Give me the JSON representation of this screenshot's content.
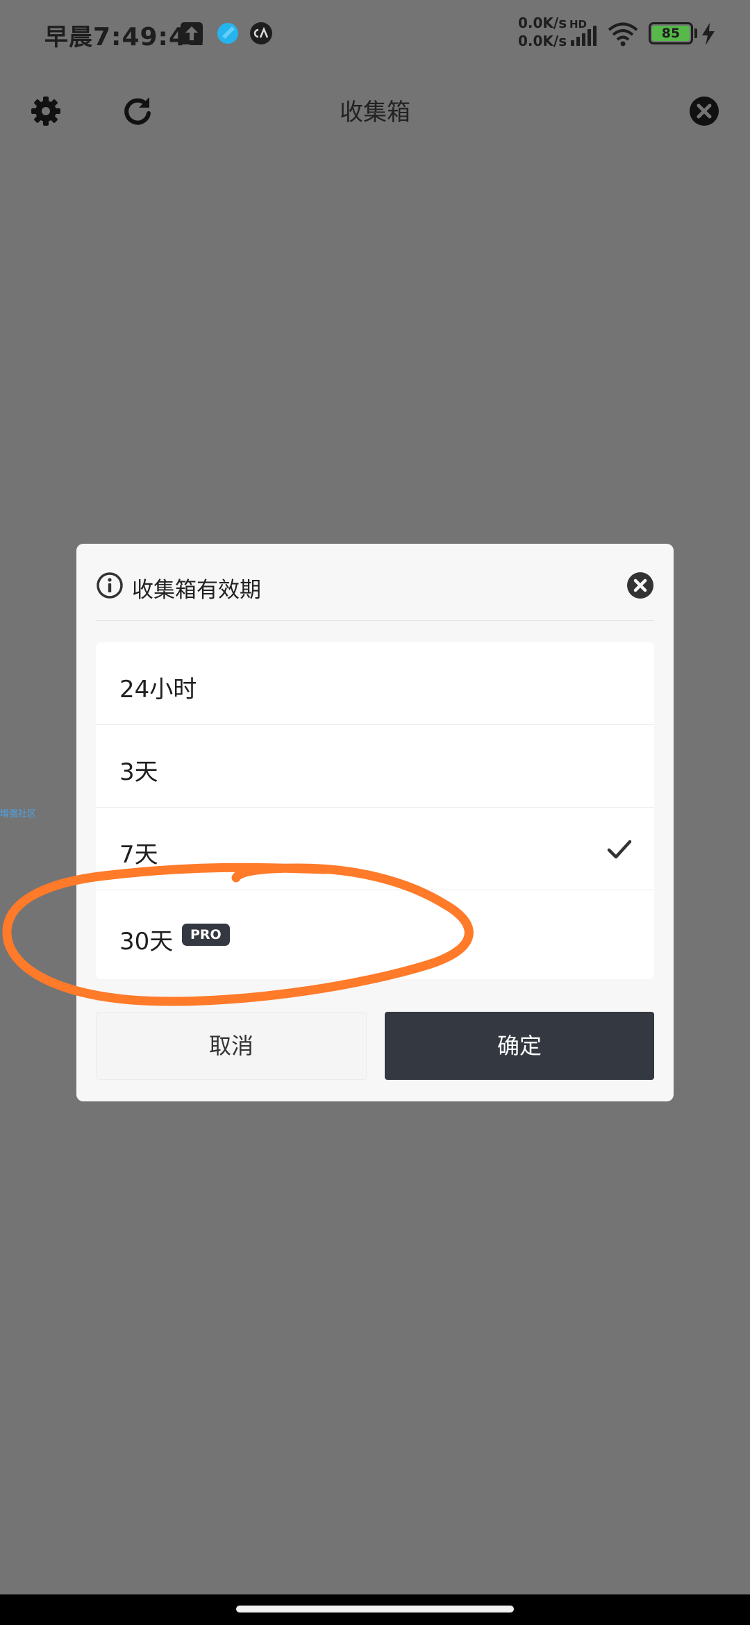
{
  "status_bar": {
    "time_prefix": "早晨",
    "time": "7:49:41",
    "net_up": "0.0K/s",
    "net_down": "0.0K/s",
    "hd_label": "HD",
    "battery_level": "85",
    "icons": [
      "upload-icon",
      "blue-app-icon",
      "ca-app-icon",
      "signal-icon",
      "wifi-icon",
      "battery-icon",
      "charging-icon"
    ]
  },
  "toolbar": {
    "title": "收集箱",
    "left_icons": [
      "gear-icon",
      "refresh-icon"
    ],
    "right_icon": "close-circle-icon"
  },
  "side_tag": {
    "text": "增强社区"
  },
  "dialog": {
    "title": "收集箱有效期",
    "options": [
      {
        "label": "24小时",
        "selected": false
      },
      {
        "label": "3天",
        "selected": false
      },
      {
        "label": "7天",
        "selected": true
      },
      {
        "label": "30天",
        "selected": false,
        "badge": "PRO"
      }
    ],
    "cancel_label": "取消",
    "confirm_label": "确定"
  },
  "colors": {
    "overlay_background": "#747474",
    "dialog_background": "#f7f7f7",
    "primary_button": "#343841",
    "annotation_stroke": "#ff7a29",
    "battery_green": "#56b94a"
  }
}
